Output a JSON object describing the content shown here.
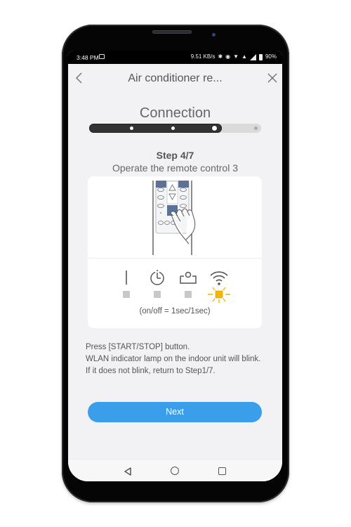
{
  "status_bar": {
    "time": "3:48 PM",
    "net_speed": "9.51 KB/s",
    "battery": "90%",
    "icons": [
      "screenshot-icon",
      "bluetooth-icon",
      "vibrate-icon",
      "wifi-icon",
      "data-transfer-icon",
      "signal-icon",
      "battery-icon"
    ]
  },
  "header": {
    "title": "Air conditioner re...",
    "back_icon": "chevron-left-icon",
    "close_icon": "close-icon"
  },
  "progress": {
    "section_title": "Connection",
    "total_steps": 4,
    "completed_steps": 3,
    "fraction_filled": 0.77
  },
  "step": {
    "label": "Step 4/7",
    "instruction": "Operate the remote control 3"
  },
  "card": {
    "illustration": "remote-control-hand-press",
    "indicators": [
      {
        "name": "power-indicator",
        "icon": "power-line-icon",
        "state": "off"
      },
      {
        "name": "timer-indicator",
        "icon": "timer-icon",
        "state": "off"
      },
      {
        "name": "filter-indicator",
        "icon": "unit-icon",
        "state": "off"
      },
      {
        "name": "wlan-indicator",
        "icon": "wifi-icon",
        "state": "blinking"
      }
    ],
    "blink_note": "(on/off = 1sec/1sec)"
  },
  "description": [
    "Press [START/STOP] button.",
    "WLAN indicator lamp on the indoor unit will blink.",
    "If it does not blink, return to Step1/7."
  ],
  "next_button": {
    "label": "Next"
  },
  "colors": {
    "accent": "#3a9eea",
    "blink": "#f5b800",
    "progress_fill": "#333333",
    "background": "#f2f2f4"
  },
  "nav_bar": {
    "back": "nav-back-icon",
    "home": "nav-home-icon",
    "recents": "nav-recents-icon"
  }
}
